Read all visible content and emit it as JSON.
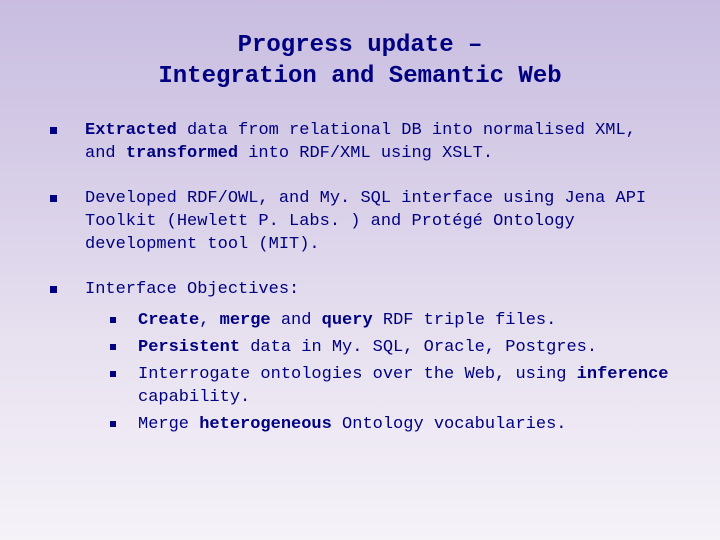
{
  "title_line1": "Progress update –",
  "title_line2": "Integration and Semantic Web",
  "bullets": {
    "b1": {
      "pre": "",
      "bold1": "Extracted",
      "mid1": " data from relational DB into normalised XML, and ",
      "bold2": "transformed",
      "post": " into RDF/XML using XSLT."
    },
    "b2": {
      "text": "Developed RDF/OWL, and My. SQL interface using Jena API Toolkit (Hewlett P. Labs. ) and Protégé Ontology development tool (MIT)."
    },
    "b3": {
      "text": "Interface Objectives:"
    }
  },
  "sub": {
    "s1": {
      "bold1": "Create",
      "t1": ", ",
      "bold2": "merge",
      "t2": " and ",
      "bold3": "query",
      "t3": " RDF triple files."
    },
    "s2": {
      "bold1": "Persistent",
      "t1": " data in My. SQL, Oracle, Postgres."
    },
    "s3": {
      "t1": "Interrogate ontologies over the Web, using ",
      "bold1": "inference",
      "t2": " capability."
    },
    "s4": {
      "t1": "Merge ",
      "bold1": "heterogeneous",
      "t2": " Ontology vocabularies."
    }
  }
}
